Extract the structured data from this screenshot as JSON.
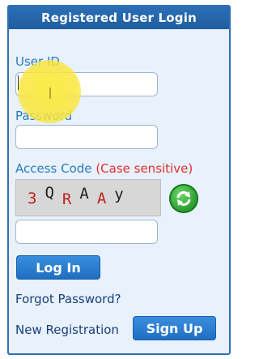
{
  "header": {
    "title": "Registered User Login"
  },
  "user_id": {
    "label": "User ID",
    "value": ""
  },
  "password": {
    "label": "Password",
    "value": ""
  },
  "access_code": {
    "label": "Access Code",
    "note": "(Case sensitive)",
    "captcha_chars": [
      "3",
      "Q",
      "R",
      "A",
      "A",
      "y"
    ],
    "value": ""
  },
  "buttons": {
    "login": "Log In",
    "signup": "Sign Up"
  },
  "links": {
    "forgot_password": "Forgot Password?",
    "new_registration": "New Registration"
  },
  "colors": {
    "header_bg": "#1f5e9f",
    "label": "#2a7bc0",
    "note": "#e0302a",
    "button": "#2a80d4",
    "panel_bg": "#e8f1fc"
  }
}
